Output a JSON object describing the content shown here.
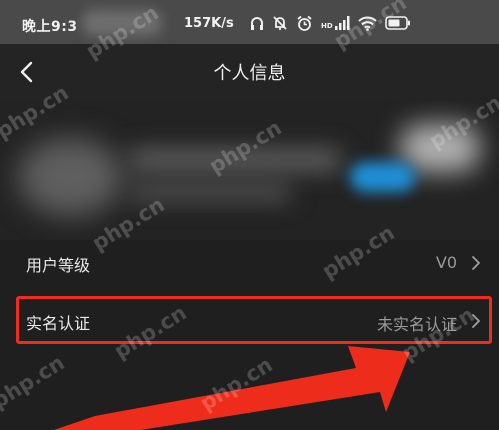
{
  "status_bar": {
    "time": "晚上9:3",
    "network_speed": "157K/s",
    "network_type": "HD",
    "icons": [
      "headphone-icon",
      "mute-bell-icon",
      "alarm-icon",
      "signal-icon",
      "wifi-icon",
      "battery-icon"
    ]
  },
  "nav": {
    "title": "个人信息",
    "back_icon": "chevron-left-icon"
  },
  "rows": {
    "level": {
      "label": "用户等级",
      "value": "V0"
    },
    "real_name": {
      "label": "实名认证",
      "value": "未实名认证"
    }
  },
  "watermark": "php.cn",
  "colors": {
    "highlight": "#ee2c1c",
    "background": "#1f1f1f",
    "status_bar": "#4a4a4a"
  }
}
